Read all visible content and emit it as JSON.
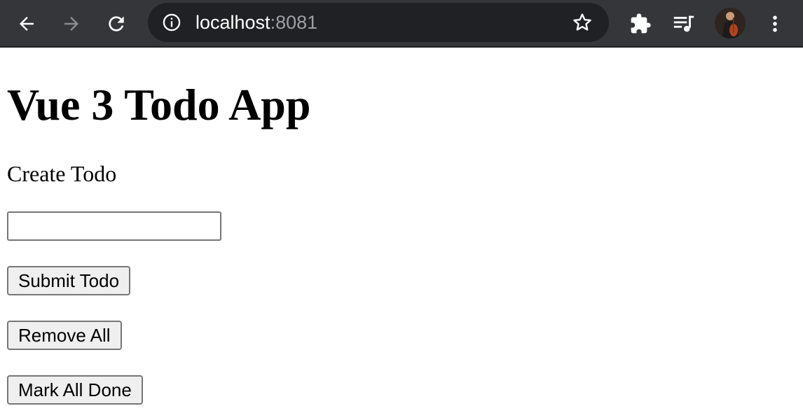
{
  "browser": {
    "url_host": "localhost",
    "url_port": ":8081",
    "icons": {
      "back": "arrow-left-icon",
      "forward": "arrow-right-icon",
      "reload": "reload-icon",
      "site_info": "info-icon",
      "bookmark": "star-icon",
      "extensions": "puzzle-icon",
      "media": "playlist-music-icon",
      "profile": "avatar",
      "menu": "kebab-menu-icon"
    },
    "colors": {
      "toolbar": "#35363a",
      "omnibox": "#202124",
      "icon": "#ffffff",
      "icon_disabled": "#8a8b8e",
      "port_text": "#9aa0a6"
    }
  },
  "page": {
    "title": "Vue 3 Todo App",
    "create_label": "Create Todo",
    "input_value": "",
    "input_placeholder": "",
    "buttons": {
      "submit": "Submit Todo",
      "remove_all": "Remove All",
      "mark_all_done": "Mark All Done"
    }
  }
}
